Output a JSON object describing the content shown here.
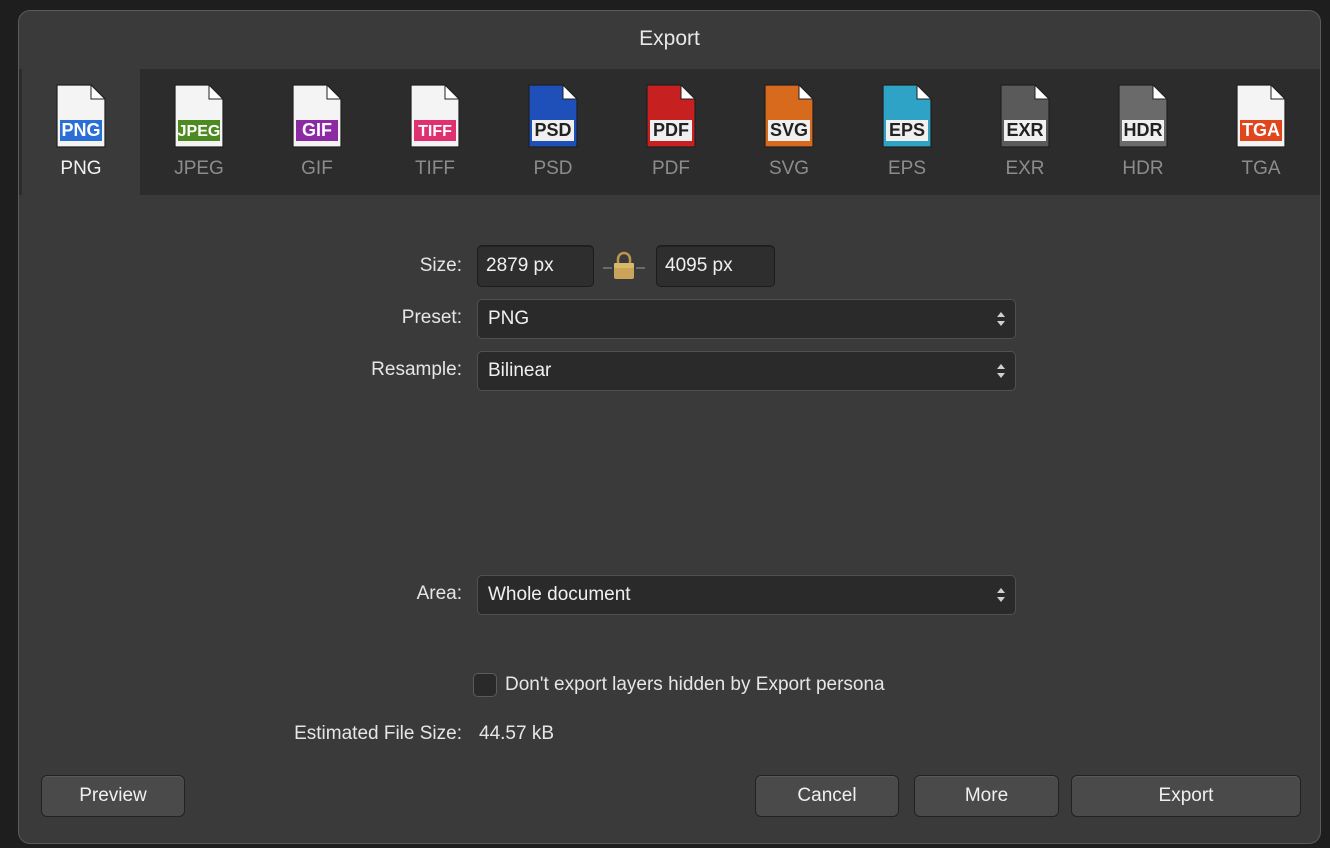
{
  "dialog": {
    "title": "Export"
  },
  "formats": [
    {
      "label": "PNG",
      "badge": "PNG",
      "color": "#2a6fd6",
      "selected": true
    },
    {
      "label": "JPEG",
      "badge": "JPEG",
      "color": "#4e8a22",
      "selected": false
    },
    {
      "label": "GIF",
      "badge": "GIF",
      "color": "#8b2aa3",
      "selected": false
    },
    {
      "label": "TIFF",
      "badge": "TIFF",
      "color": "#e0306f",
      "selected": false
    },
    {
      "label": "PSD",
      "badge": "PSD",
      "color": "#1f4fb8",
      "selected": false
    },
    {
      "label": "PDF",
      "badge": "PDF",
      "color": "#c62020",
      "selected": false
    },
    {
      "label": "SVG",
      "badge": "SVG",
      "color": "#d86a1e",
      "selected": false
    },
    {
      "label": "EPS",
      "badge": "EPS",
      "color": "#2fa3c5",
      "selected": false
    },
    {
      "label": "EXR",
      "badge": "EXR",
      "color": "#5a5a5a",
      "selected": false
    },
    {
      "label": "HDR",
      "badge": "HDR",
      "color": "#6a6a6a",
      "selected": false
    },
    {
      "label": "TGA",
      "badge": "TGA",
      "color": "#e0451c",
      "selected": false
    }
  ],
  "size": {
    "label": "Size:",
    "width": "2879 px",
    "height": "4095 px"
  },
  "preset": {
    "label": "Preset:",
    "value": "PNG"
  },
  "resample": {
    "label": "Resample:",
    "value": "Bilinear"
  },
  "area": {
    "label": "Area:",
    "value": "Whole document"
  },
  "hidden_layers": {
    "label": "Don't export layers hidden by Export persona",
    "checked": false
  },
  "estimate": {
    "label": "Estimated File Size:",
    "value": "44.57 kB"
  },
  "buttons": {
    "preview": "Preview",
    "cancel": "Cancel",
    "more": "More",
    "export": "Export"
  }
}
